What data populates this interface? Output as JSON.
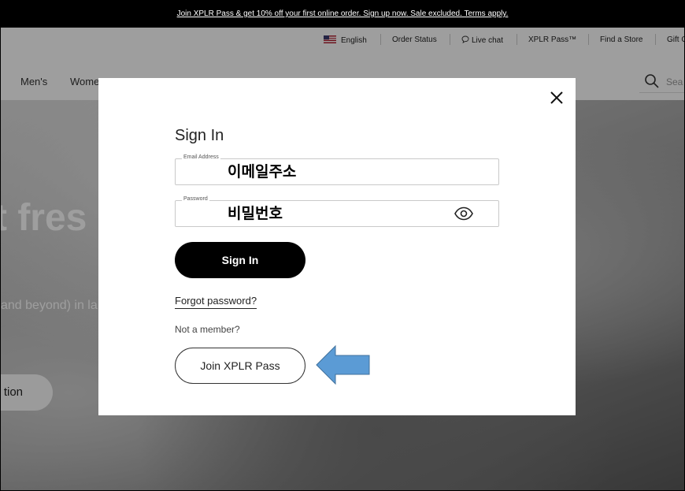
{
  "promo": {
    "text": "Join XPLR Pass & get 10% off your first online order. Sign up now. Sale excluded. Terms apply."
  },
  "utility": {
    "language": "English",
    "order_status": "Order Status",
    "live_chat": "Live chat",
    "xplr_pass": "XPLR Pass™",
    "find_store": "Find a Store",
    "gift": "Gift C"
  },
  "nav": {
    "mens": "Men's",
    "womens": "Wome",
    "search_placeholder": "Sea"
  },
  "hero": {
    "title": "t fres",
    "subtitle": "and beyond) in la",
    "cta": "tion"
  },
  "modal": {
    "title": "Sign In",
    "email_label": "Email Address",
    "email_placeholder": "이메일주소",
    "password_label": "Password",
    "password_placeholder": "비밀번호",
    "signin_label": "Sign In",
    "forgot_label": "Forgot password?",
    "not_member": "Not a member?",
    "join_label": "Join XPLR Pass"
  },
  "colors": {
    "arrow": "#5b9bd5",
    "primary_button": "#000000"
  },
  "icons": [
    "flag-us-icon",
    "chat-bubble-icon",
    "search-icon",
    "close-icon",
    "eye-icon",
    "arrow-left-icon"
  ]
}
